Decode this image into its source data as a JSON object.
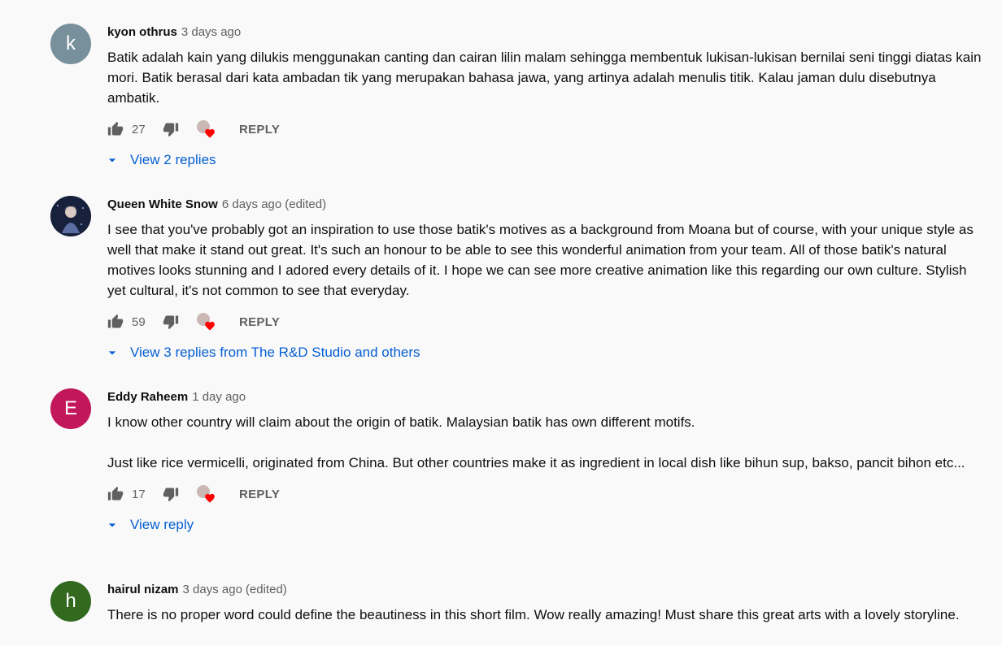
{
  "colors": {
    "link": "#065fd4",
    "muted": "#606060",
    "heart": "#ff0000"
  },
  "comments": [
    {
      "avatar_letter": "k",
      "avatar_color": "#78909c",
      "author": "kyon othrus",
      "time": "3 days ago",
      "edited": "",
      "text": "Batik adalah kain yang dilukis menggunakan canting dan cairan lilin malam sehingga membentuk lukisan-lukisan bernilai seni tinggi diatas kain mori. Batik berasal dari kata ambadan tik yang merupakan bahasa jawa, yang artinya adalah menulis titik. Kalau jaman dulu disebutnya ambatik.",
      "likes": "27",
      "reply_label": "REPLY",
      "view_replies": "View 2 replies"
    },
    {
      "avatar_letter": "",
      "avatar_color": "#1c2a4a",
      "author": "Queen White Snow",
      "time": "6 days ago",
      "edited": "(edited)",
      "text": "I see that you've probably got an inspiration to use those batik's motives as a background from Moana but of course, with your unique style as well that make it stand out great. It's such an honour to be able to see this wonderful animation from your team. All of those batik's natural motives looks stunning and I adored every details of it. I hope we can see more creative animation like this regarding our own culture. Stylish yet cultural, it's not common to see that everyday.",
      "likes": "59",
      "reply_label": "REPLY",
      "view_replies": "View 3 replies from The R&D Studio and others"
    },
    {
      "avatar_letter": "E",
      "avatar_color": "#c2185b",
      "author": "Eddy Raheem",
      "time": "1 day ago",
      "edited": "",
      "text": "I know other country will claim about the origin of batik. Malaysian batik has own different motifs.\n\nJust like rice vermicelli, originated from China. But other countries make it as ingredient in local dish like bihun sup, bakso, pancit bihon etc...",
      "likes": "17",
      "reply_label": "REPLY",
      "view_replies": "View reply"
    },
    {
      "avatar_letter": "h",
      "avatar_color": "#33691e",
      "author": "hairul nizam",
      "time": "3 days ago",
      "edited": "(edited)",
      "text": "There is no proper word could define the beautiness in this short film. Wow really amazing! Must share this great arts with a lovely storyline."
    }
  ]
}
